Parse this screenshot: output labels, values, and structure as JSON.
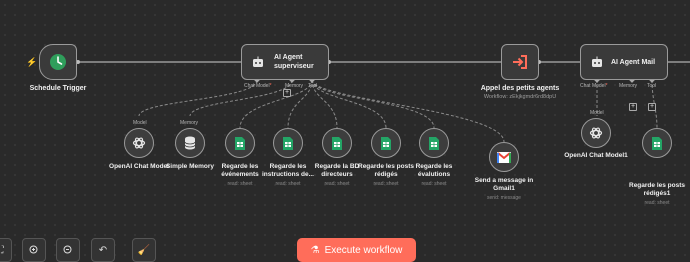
{
  "colors": {
    "canvas_bg": "#2a2a2a",
    "node_bg": "#3a3a3a",
    "node_border": "#9a9a9a",
    "accent": "#ff6d5a",
    "trigger_green": "#2f9e5b",
    "sheet_green": "#23a566"
  },
  "trigger": {
    "label": "Schedule Trigger",
    "icon": "clock-icon",
    "bolt": "lightning-icon"
  },
  "supervisor": {
    "title_line1": "AI Agent",
    "title_line2": "superviseur",
    "icon": "robot-icon",
    "port_chat": "Chat Model",
    "port_memory": "Memory",
    "port_tool": "Tool",
    "required_mark": "*"
  },
  "call_agents": {
    "label": "Appel des petits agents",
    "sub": "Workflow: zEkjkgmdr6rd8dpU",
    "icon": "enter-icon"
  },
  "mail_agent": {
    "title": "AI Agent Mail",
    "icon": "robot-icon",
    "port_chat": "Chat Model",
    "port_memory": "Memory",
    "port_tool": "Tool",
    "required_mark": "*"
  },
  "sub_nodes": [
    {
      "caption_top": "Model",
      "line1": "OpenAI Chat Model",
      "line2": "",
      "sub": "",
      "icon": "openai-icon"
    },
    {
      "caption_top": "Memory",
      "line1": "Simple Memory",
      "line2": "",
      "sub": "",
      "icon": "database-icon"
    },
    {
      "caption_top": "",
      "line1": "Regarde les",
      "line2": "événements",
      "sub": "read: sheet",
      "icon": "sheets-icon"
    },
    {
      "caption_top": "",
      "line1": "Regarde les",
      "line2": "instructions de...",
      "sub": "read: sheet",
      "icon": "sheets-icon"
    },
    {
      "caption_top": "",
      "line1": "Regarde la BD",
      "line2": "directeurs",
      "sub": "read: sheet",
      "icon": "sheets-icon"
    },
    {
      "caption_top": "",
      "line1": "Regarde les posts",
      "line2": "rédigés",
      "sub": "read: sheet",
      "icon": "sheets-icon"
    },
    {
      "caption_top": "",
      "line1": "Regarde les",
      "line2": "évalutions",
      "sub": "read: sheet",
      "icon": "sheets-icon"
    },
    {
      "caption_top": "",
      "line1": "Send a message in",
      "line2": "Gmail1",
      "sub": "send: message",
      "icon": "gmail-icon"
    }
  ],
  "mail_sub_nodes": [
    {
      "caption_top": "Model",
      "line1": "OpenAI Chat Model1",
      "line2": "",
      "sub": "",
      "icon": "openai-icon"
    },
    {
      "caption_top": "",
      "line1": "Regarde les posts",
      "line2": "rédigés1",
      "sub": "read: sheet",
      "icon": "sheets-icon"
    }
  ],
  "bottom_toolbar": {
    "fit_icon": "fit-view-icon",
    "zoom_in_icon": "zoom-in-icon",
    "zoom_out_icon": "zoom-out-icon",
    "undo_icon": "undo-icon",
    "clean_icon": "broom-icon",
    "execute_label": "Execute workflow",
    "execute_icon": "flask-icon"
  }
}
